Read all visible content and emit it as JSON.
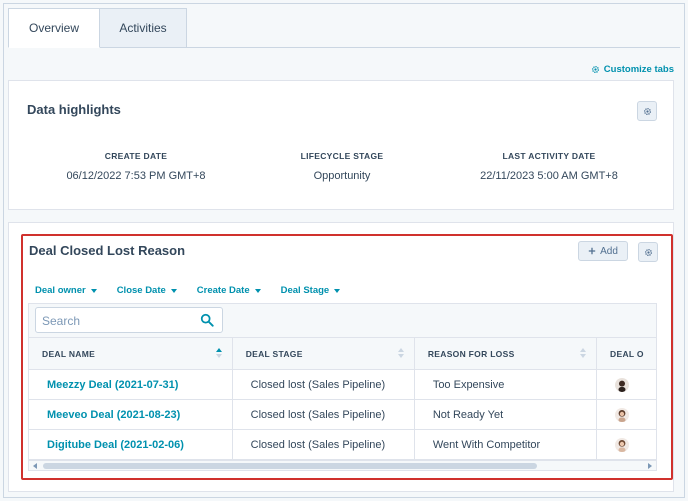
{
  "tabs": [
    {
      "label": "Overview",
      "active": true
    },
    {
      "label": "Activities",
      "active": false
    }
  ],
  "customize": {
    "label": "Customize tabs",
    "icon": "gear-icon"
  },
  "highlights": {
    "title": "Data highlights",
    "stats": [
      {
        "label": "CREATE DATE",
        "value": "06/12/2022 7:53 PM GMT+8"
      },
      {
        "label": "LIFECYCLE STAGE",
        "value": "Opportunity"
      },
      {
        "label": "LAST ACTIVITY DATE",
        "value": "22/11/2023 5:00 AM GMT+8"
      }
    ]
  },
  "deal_card": {
    "title": "Deal Closed Lost Reason",
    "add_label": "Add",
    "filters": [
      "Deal owner",
      "Close Date",
      "Create Date",
      "Deal Stage"
    ],
    "search": {
      "placeholder": "Search",
      "value": ""
    },
    "columns": [
      "DEAL NAME",
      "DEAL STAGE",
      "REASON FOR LOSS",
      "DEAL O"
    ],
    "rows": [
      {
        "name": "Meezzy Deal (2021-07-31)",
        "stage": "Closed lost (Sales Pipeline)",
        "reason": "Too Expensive"
      },
      {
        "name": "Meeveo Deal (2021-08-23)",
        "stage": "Closed lost (Sales Pipeline)",
        "reason": "Not Ready Yet"
      },
      {
        "name": "Digitube Deal (2021-02-06)",
        "stage": "Closed lost (Sales Pipeline)",
        "reason": "Went With Competitor"
      }
    ]
  },
  "colors": {
    "accent": "#0091ae",
    "text": "#33475b",
    "highlight_border": "#d0312d"
  }
}
